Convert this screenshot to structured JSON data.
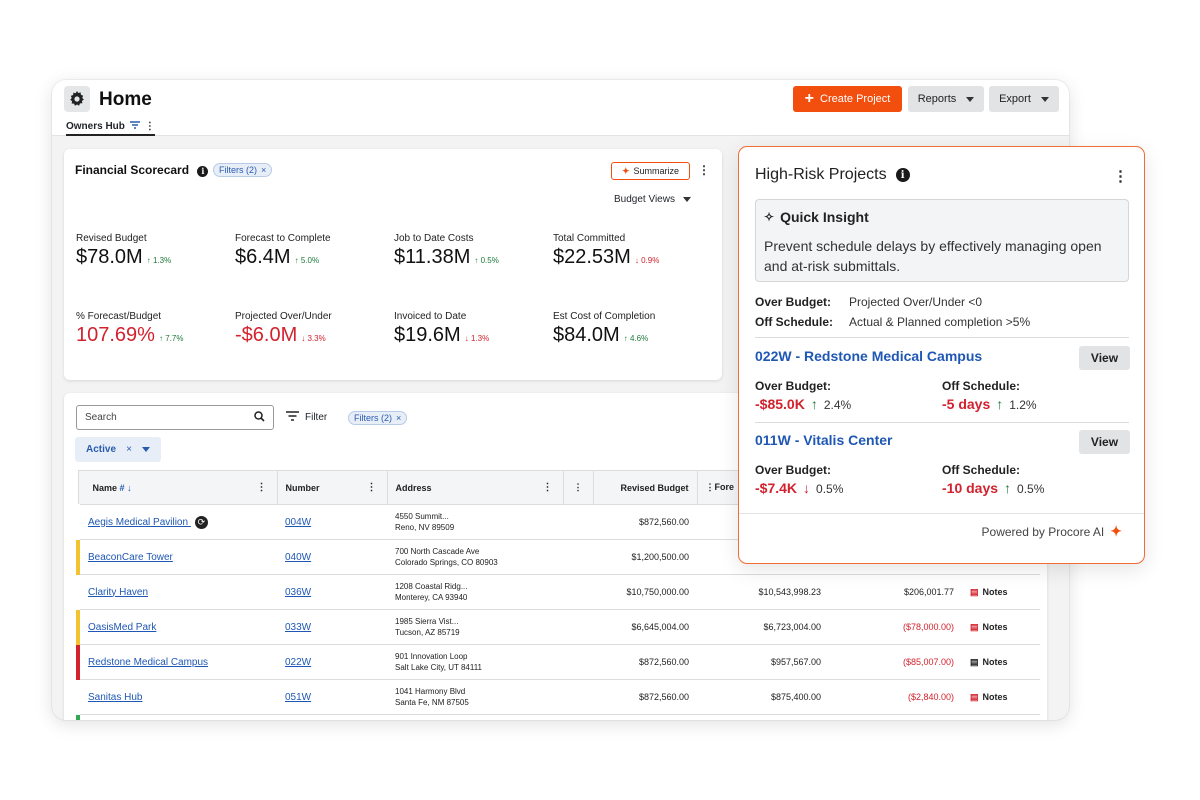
{
  "header": {
    "title": "Home",
    "tab": "Owners Hub",
    "create_label": "Create Project",
    "reports_label": "Reports",
    "export_label": "Export"
  },
  "scorecard": {
    "title": "Financial Scorecard",
    "filters_label": "Filters (2)",
    "summarize_label": "Summarize",
    "views_label": "Budget Views",
    "metrics": [
      {
        "label": "Revised Budget",
        "value": "$78.0M",
        "change": "1.3%",
        "dir": "up"
      },
      {
        "label": "Forecast to Complete",
        "value": "$6.4M",
        "change": "5.0%",
        "dir": "up"
      },
      {
        "label": "Job to Date Costs",
        "value": "$11.38M",
        "change": "0.5%",
        "dir": "up"
      },
      {
        "label": "Total Committed",
        "value": "$22.53M",
        "change": "0.9%",
        "dir": "down"
      },
      {
        "label": "% Forecast/Budget",
        "value": "107.69%",
        "change": "7.7%",
        "dir": "up"
      },
      {
        "label": "Projected Over/Under",
        "value": "-$6.0M",
        "change": "3.3%",
        "dir": "down"
      },
      {
        "label": "Invoiced to Date",
        "value": "$19.6M",
        "change": "1.3%",
        "dir": "down"
      },
      {
        "label": "Est Cost of Completion",
        "value": "$84.0M",
        "change": "4.6%",
        "dir": "up"
      }
    ]
  },
  "table": {
    "search_placeholder": "Search",
    "filter_label": "Filter",
    "filters_pill": "Filters (2)",
    "status_tag": "Active",
    "headers": {
      "name": "Name",
      "hash": "#",
      "number": "Number",
      "address": "Address",
      "revised_budget": "Revised Budget",
      "forecast": "Fore"
    },
    "rows": [
      {
        "name": "Aegis Medical Pavilion",
        "number": "004W",
        "addr1": "4550 Summit...",
        "addr2": "Reno, NV 89509",
        "revised": "$872,560.00",
        "forecast": "",
        "variance": "",
        "flag": ""
      },
      {
        "name": "BeaconCare Tower",
        "number": "040W",
        "addr1": "700 North Cascade Ave",
        "addr2": " Colorado Springs, CO 80903",
        "revised": "$1,200,500.00",
        "forecast": "",
        "variance": "",
        "flag": "#f2c230"
      },
      {
        "name": "Clarity Haven",
        "number": "036W",
        "addr1": "1208 Coastal Ridg...",
        "addr2": "Monterey, CA 93940",
        "revised": "$10,750,000.00",
        "forecast": "$10,543,998.23",
        "variance": "$206,001.77",
        "flag": ""
      },
      {
        "name": "OasisMed Park",
        "number": "033W",
        "addr1": "1985 Sierra Vist...",
        "addr2": "Tucson, AZ 85719",
        "revised": "$6,645,004.00",
        "forecast": "$6,723,004.00",
        "variance": "($78,000.00)",
        "flag": "#f2c230"
      },
      {
        "name": "Redstone Medical Campus",
        "number": "022W",
        "addr1": "901 Innovation Loop",
        "addr2": "Salt Lake City, UT 84111",
        "revised": "$872,560.00",
        "forecast": "$957,567.00",
        "variance": "($85,007.00)",
        "flag": "#d2222d"
      },
      {
        "name": "Sanitas Hub",
        "number": "051W",
        "addr1": "1041 Harmony Blvd",
        "addr2": "Santa Fe, NM 87505",
        "revised": "$872,560.00",
        "forecast": "$875,400.00",
        "variance": "($2,840.00)",
        "flag": ""
      }
    ],
    "notes_label": "Notes"
  },
  "high_risk": {
    "title": "High-Risk Projects",
    "insight_title": "Quick Insight",
    "insight_text": "Prevent schedule delays by effectively managing open and at-risk submittals.",
    "criteria": [
      {
        "label": "Over Budget:",
        "value": "Projected Over/Under <0"
      },
      {
        "label": "Off Schedule:",
        "value": "Actual & Planned completion >5%"
      }
    ],
    "projects": [
      {
        "name": "022W - Redstone Medical Campus",
        "over_label": "Over Budget:",
        "over_value": "-$85.0K",
        "over_change": "2.4%",
        "over_dir": "up",
        "off_label": "Off Schedule:",
        "off_value": "-5 days",
        "off_change": "1.2%",
        "off_dir": "up"
      },
      {
        "name": "011W - Vitalis Center",
        "over_label": "Over Budget:",
        "over_value": "-$7.4K",
        "over_change": "0.5%",
        "over_dir": "down",
        "off_label": "Off Schedule:",
        "off_value": "-10 days",
        "off_change": "0.5%",
        "off_dir": "up"
      }
    ],
    "view_label": "View",
    "powered_by": "Powered by Procore AI"
  },
  "colors": {
    "accent": "#f24e0d",
    "link": "#1f57b5",
    "negative": "#d2222d",
    "positive": "#1f7a3a"
  }
}
